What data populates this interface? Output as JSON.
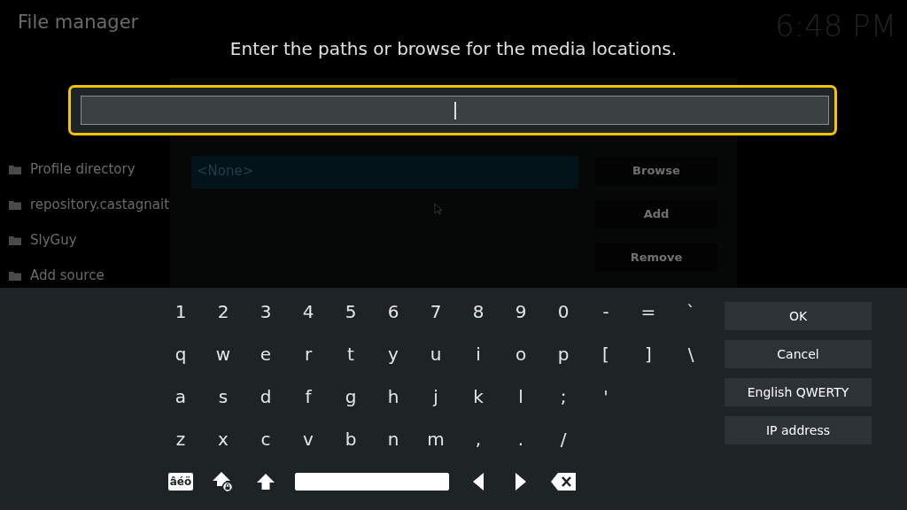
{
  "header": {
    "title": "File manager",
    "clock": "6:48 PM"
  },
  "sources": [
    {
      "label": "Profile directory"
    },
    {
      "label": "repository.castagnait"
    },
    {
      "label": "SlyGuy"
    },
    {
      "label": "Add source"
    }
  ],
  "source_dialog": {
    "paths": [
      {
        "text": "<None>",
        "selected": true
      }
    ],
    "buttons": [
      "Browse",
      "Add",
      "Remove"
    ]
  },
  "keyboard": {
    "heading": "Enter the paths or browse for the media locations.",
    "rows": [
      [
        "1",
        "2",
        "3",
        "4",
        "5",
        "6",
        "7",
        "8",
        "9",
        "0",
        "-",
        "=",
        "`"
      ],
      [
        "q",
        "w",
        "e",
        "r",
        "t",
        "y",
        "u",
        "i",
        "o",
        "p",
        "[",
        "]",
        "\\"
      ],
      [
        "a",
        "s",
        "d",
        "f",
        "g",
        "h",
        "j",
        "k",
        "l",
        ";",
        "'"
      ],
      [
        "z",
        "x",
        "c",
        "v",
        "b",
        "n",
        "m",
        ",",
        ".",
        "/"
      ]
    ],
    "special_keys": [
      {
        "kind": "accents",
        "label": "âéö"
      },
      {
        "kind": "caps_lock"
      },
      {
        "kind": "shift"
      },
      {
        "kind": "space"
      },
      {
        "kind": "left"
      },
      {
        "kind": "right"
      },
      {
        "kind": "backspace"
      }
    ],
    "actions": [
      "OK",
      "Cancel",
      "English QWERTY",
      "IP address"
    ]
  }
}
